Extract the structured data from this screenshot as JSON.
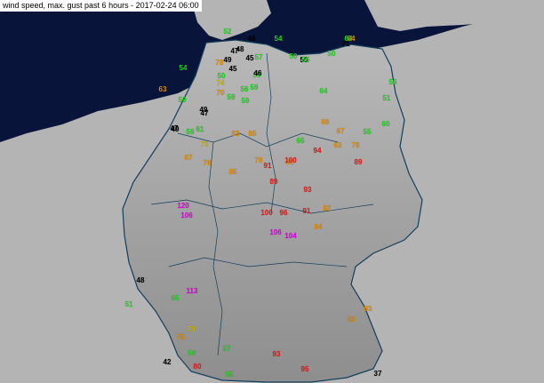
{
  "title": "wind speed, max. gust past 6 hours - 2017-02-24 06:00",
  "colors": {
    "sea": "#08143a",
    "land_outside": "#b4b4b4",
    "germany": "#9c9c9c",
    "border": "#123f5a",
    "legend_band_black": "#000000",
    "legend_band_green": "#1fd21f",
    "legend_band_orange_light": "#c8b400",
    "legend_band_orange": "#e08a00",
    "legend_band_red": "#e51b1b",
    "legend_band_magenta": "#e000e0"
  },
  "stations": [
    {
      "v": "64",
      "c": "#1fd21f"
    },
    {
      "v": "71",
      "c": "#000000"
    },
    {
      "v": "64",
      "c": "#e08a00"
    },
    {
      "v": "46",
      "c": "#000000"
    },
    {
      "v": "54",
      "c": "#1fd21f"
    },
    {
      "v": "50",
      "c": "#1fd21f"
    },
    {
      "v": "50",
      "c": "#1fd21f"
    },
    {
      "v": "52",
      "c": "#1fd21f"
    },
    {
      "v": "47",
      "c": "#000000"
    },
    {
      "v": "45",
      "c": "#000000"
    },
    {
      "v": "49",
      "c": "#000000"
    },
    {
      "v": "50",
      "c": "#000000"
    },
    {
      "v": "48",
      "c": "#000000"
    },
    {
      "v": "45",
      "c": "#000000"
    },
    {
      "v": "59",
      "c": "#1fd21f"
    },
    {
      "v": "78",
      "c": "#e08a00"
    },
    {
      "v": "50",
      "c": "#1fd21f"
    },
    {
      "v": "56",
      "c": "#1fd21f"
    },
    {
      "v": "57",
      "c": "#1fd21f"
    },
    {
      "v": "54",
      "c": "#1fd21f"
    },
    {
      "v": "74",
      "c": "#c8b400"
    },
    {
      "v": "59",
      "c": "#1fd21f"
    },
    {
      "v": "56",
      "c": "#1fd21f"
    },
    {
      "v": "46",
      "c": "#000000"
    },
    {
      "v": "70",
      "c": "#e08a00"
    },
    {
      "v": "47",
      "c": "#000000"
    },
    {
      "v": "59",
      "c": "#1fd21f"
    },
    {
      "v": "59",
      "c": "#1fd21f"
    },
    {
      "v": "49",
      "c": "#000000"
    },
    {
      "v": "64",
      "c": "#1fd21f"
    },
    {
      "v": "78",
      "c": "#e08a00"
    },
    {
      "v": "65",
      "c": "#1fd21f"
    },
    {
      "v": "69",
      "c": "#e08a00"
    },
    {
      "v": "60",
      "c": "#1fd21f"
    },
    {
      "v": "56",
      "c": "#1fd21f"
    },
    {
      "v": "51",
      "c": "#1fd21f"
    },
    {
      "v": "63",
      "c": "#e08a00"
    },
    {
      "v": "55",
      "c": "#1fd21f"
    },
    {
      "v": "55",
      "c": "#1fd21f"
    },
    {
      "v": "67",
      "c": "#e08a00"
    },
    {
      "v": "59",
      "c": "#1fd21f"
    },
    {
      "v": "49",
      "c": "#000000"
    },
    {
      "v": "61",
      "c": "#1fd21f"
    },
    {
      "v": "47",
      "c": "#000000"
    },
    {
      "v": "73",
      "c": "#c8b400"
    },
    {
      "v": "83",
      "c": "#e08a00"
    },
    {
      "v": "85",
      "c": "#e08a00"
    },
    {
      "v": "67",
      "c": "#e08a00"
    },
    {
      "v": "76",
      "c": "#e08a00"
    },
    {
      "v": "85",
      "c": "#e08a00"
    },
    {
      "v": "78",
      "c": "#e08a00"
    },
    {
      "v": "83",
      "c": "#e08a00"
    },
    {
      "v": "63",
      "c": "#e08a00"
    },
    {
      "v": "100",
      "c": "#e51b1b"
    },
    {
      "v": "94",
      "c": "#e51b1b"
    },
    {
      "v": "89",
      "c": "#e51b1b"
    },
    {
      "v": "91",
      "c": "#e51b1b"
    },
    {
      "v": "93",
      "c": "#e51b1b"
    },
    {
      "v": "120",
      "c": "#e000e0"
    },
    {
      "v": "106",
      "c": "#e000e0"
    },
    {
      "v": "100",
      "c": "#e51b1b"
    },
    {
      "v": "89",
      "c": "#e51b1b"
    },
    {
      "v": "96",
      "c": "#e51b1b"
    },
    {
      "v": "91",
      "c": "#e51b1b"
    },
    {
      "v": "106",
      "c": "#e000e0"
    },
    {
      "v": "104",
      "c": "#e000e0"
    },
    {
      "v": "84",
      "c": "#e08a00"
    },
    {
      "v": "82",
      "c": "#e08a00"
    },
    {
      "v": "113",
      "c": "#e000e0"
    },
    {
      "v": "65",
      "c": "#1fd21f"
    },
    {
      "v": "70",
      "c": "#c8b400"
    },
    {
      "v": "42",
      "c": "#000000"
    },
    {
      "v": "56",
      "c": "#1fd21f"
    },
    {
      "v": "57",
      "c": "#1fd21f"
    },
    {
      "v": "80",
      "c": "#e51b1b"
    },
    {
      "v": "75",
      "c": "#e08a00"
    },
    {
      "v": "93",
      "c": "#e51b1b"
    },
    {
      "v": "37",
      "c": "#000000"
    },
    {
      "v": "95",
      "c": "#e51b1b"
    },
    {
      "v": "63",
      "c": "#e08a00"
    },
    {
      "v": "83",
      "c": "#e08a00"
    },
    {
      "v": "48",
      "c": "#000000"
    },
    {
      "v": "51",
      "c": "#1fd21f"
    },
    {
      "v": "55",
      "c": "#1fd21f"
    }
  ]
}
